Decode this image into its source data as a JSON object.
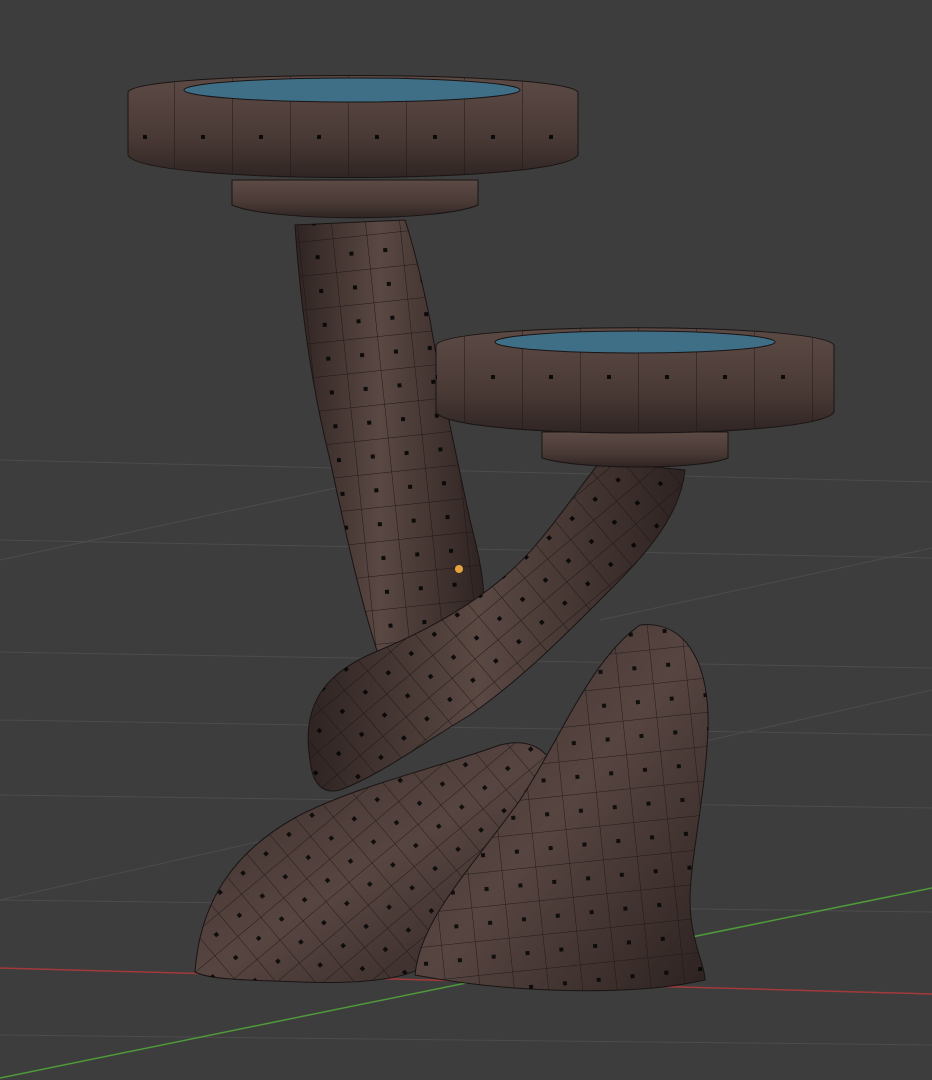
{
  "viewport": {
    "mode": "edit-mode",
    "shading": "solid",
    "wireframe_overlay": true,
    "colors": {
      "background": "#3d3d3d",
      "grid_line": "#4c4c4c",
      "x_axis": "#a33a3a",
      "y_axis": "#4f9a3a",
      "mesh_surface": "#4a3a37",
      "mesh_highlight": "#5e4c48",
      "mesh_wire": "#1a1414",
      "vertex": "#050505",
      "water": "#3f6f86",
      "origin_point": "#e6a23c"
    }
  },
  "object": {
    "type": "mesh",
    "icon": "mesh-object",
    "selected": true
  }
}
